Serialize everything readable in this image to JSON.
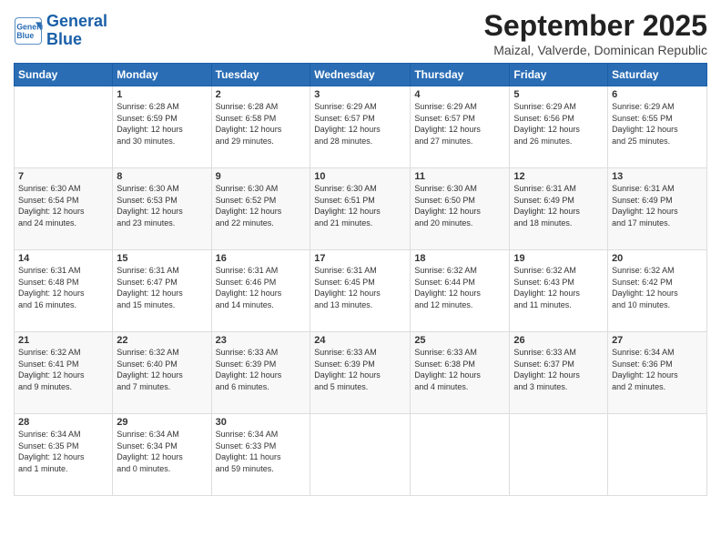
{
  "logo": {
    "line1": "General",
    "line2": "Blue"
  },
  "title": "September 2025",
  "subtitle": "Maizal, Valverde, Dominican Republic",
  "days_of_week": [
    "Sunday",
    "Monday",
    "Tuesday",
    "Wednesday",
    "Thursday",
    "Friday",
    "Saturday"
  ],
  "weeks": [
    [
      {
        "num": "",
        "info": ""
      },
      {
        "num": "1",
        "info": "Sunrise: 6:28 AM\nSunset: 6:59 PM\nDaylight: 12 hours\nand 30 minutes."
      },
      {
        "num": "2",
        "info": "Sunrise: 6:28 AM\nSunset: 6:58 PM\nDaylight: 12 hours\nand 29 minutes."
      },
      {
        "num": "3",
        "info": "Sunrise: 6:29 AM\nSunset: 6:57 PM\nDaylight: 12 hours\nand 28 minutes."
      },
      {
        "num": "4",
        "info": "Sunrise: 6:29 AM\nSunset: 6:57 PM\nDaylight: 12 hours\nand 27 minutes."
      },
      {
        "num": "5",
        "info": "Sunrise: 6:29 AM\nSunset: 6:56 PM\nDaylight: 12 hours\nand 26 minutes."
      },
      {
        "num": "6",
        "info": "Sunrise: 6:29 AM\nSunset: 6:55 PM\nDaylight: 12 hours\nand 25 minutes."
      }
    ],
    [
      {
        "num": "7",
        "info": "Sunrise: 6:30 AM\nSunset: 6:54 PM\nDaylight: 12 hours\nand 24 minutes."
      },
      {
        "num": "8",
        "info": "Sunrise: 6:30 AM\nSunset: 6:53 PM\nDaylight: 12 hours\nand 23 minutes."
      },
      {
        "num": "9",
        "info": "Sunrise: 6:30 AM\nSunset: 6:52 PM\nDaylight: 12 hours\nand 22 minutes."
      },
      {
        "num": "10",
        "info": "Sunrise: 6:30 AM\nSunset: 6:51 PM\nDaylight: 12 hours\nand 21 minutes."
      },
      {
        "num": "11",
        "info": "Sunrise: 6:30 AM\nSunset: 6:50 PM\nDaylight: 12 hours\nand 20 minutes."
      },
      {
        "num": "12",
        "info": "Sunrise: 6:31 AM\nSunset: 6:49 PM\nDaylight: 12 hours\nand 18 minutes."
      },
      {
        "num": "13",
        "info": "Sunrise: 6:31 AM\nSunset: 6:49 PM\nDaylight: 12 hours\nand 17 minutes."
      }
    ],
    [
      {
        "num": "14",
        "info": "Sunrise: 6:31 AM\nSunset: 6:48 PM\nDaylight: 12 hours\nand 16 minutes."
      },
      {
        "num": "15",
        "info": "Sunrise: 6:31 AM\nSunset: 6:47 PM\nDaylight: 12 hours\nand 15 minutes."
      },
      {
        "num": "16",
        "info": "Sunrise: 6:31 AM\nSunset: 6:46 PM\nDaylight: 12 hours\nand 14 minutes."
      },
      {
        "num": "17",
        "info": "Sunrise: 6:31 AM\nSunset: 6:45 PM\nDaylight: 12 hours\nand 13 minutes."
      },
      {
        "num": "18",
        "info": "Sunrise: 6:32 AM\nSunset: 6:44 PM\nDaylight: 12 hours\nand 12 minutes."
      },
      {
        "num": "19",
        "info": "Sunrise: 6:32 AM\nSunset: 6:43 PM\nDaylight: 12 hours\nand 11 minutes."
      },
      {
        "num": "20",
        "info": "Sunrise: 6:32 AM\nSunset: 6:42 PM\nDaylight: 12 hours\nand 10 minutes."
      }
    ],
    [
      {
        "num": "21",
        "info": "Sunrise: 6:32 AM\nSunset: 6:41 PM\nDaylight: 12 hours\nand 9 minutes."
      },
      {
        "num": "22",
        "info": "Sunrise: 6:32 AM\nSunset: 6:40 PM\nDaylight: 12 hours\nand 7 minutes."
      },
      {
        "num": "23",
        "info": "Sunrise: 6:33 AM\nSunset: 6:39 PM\nDaylight: 12 hours\nand 6 minutes."
      },
      {
        "num": "24",
        "info": "Sunrise: 6:33 AM\nSunset: 6:39 PM\nDaylight: 12 hours\nand 5 minutes."
      },
      {
        "num": "25",
        "info": "Sunrise: 6:33 AM\nSunset: 6:38 PM\nDaylight: 12 hours\nand 4 minutes."
      },
      {
        "num": "26",
        "info": "Sunrise: 6:33 AM\nSunset: 6:37 PM\nDaylight: 12 hours\nand 3 minutes."
      },
      {
        "num": "27",
        "info": "Sunrise: 6:34 AM\nSunset: 6:36 PM\nDaylight: 12 hours\nand 2 minutes."
      }
    ],
    [
      {
        "num": "28",
        "info": "Sunrise: 6:34 AM\nSunset: 6:35 PM\nDaylight: 12 hours\nand 1 minute."
      },
      {
        "num": "29",
        "info": "Sunrise: 6:34 AM\nSunset: 6:34 PM\nDaylight: 12 hours\nand 0 minutes."
      },
      {
        "num": "30",
        "info": "Sunrise: 6:34 AM\nSunset: 6:33 PM\nDaylight: 11 hours\nand 59 minutes."
      },
      {
        "num": "",
        "info": ""
      },
      {
        "num": "",
        "info": ""
      },
      {
        "num": "",
        "info": ""
      },
      {
        "num": "",
        "info": ""
      }
    ]
  ]
}
